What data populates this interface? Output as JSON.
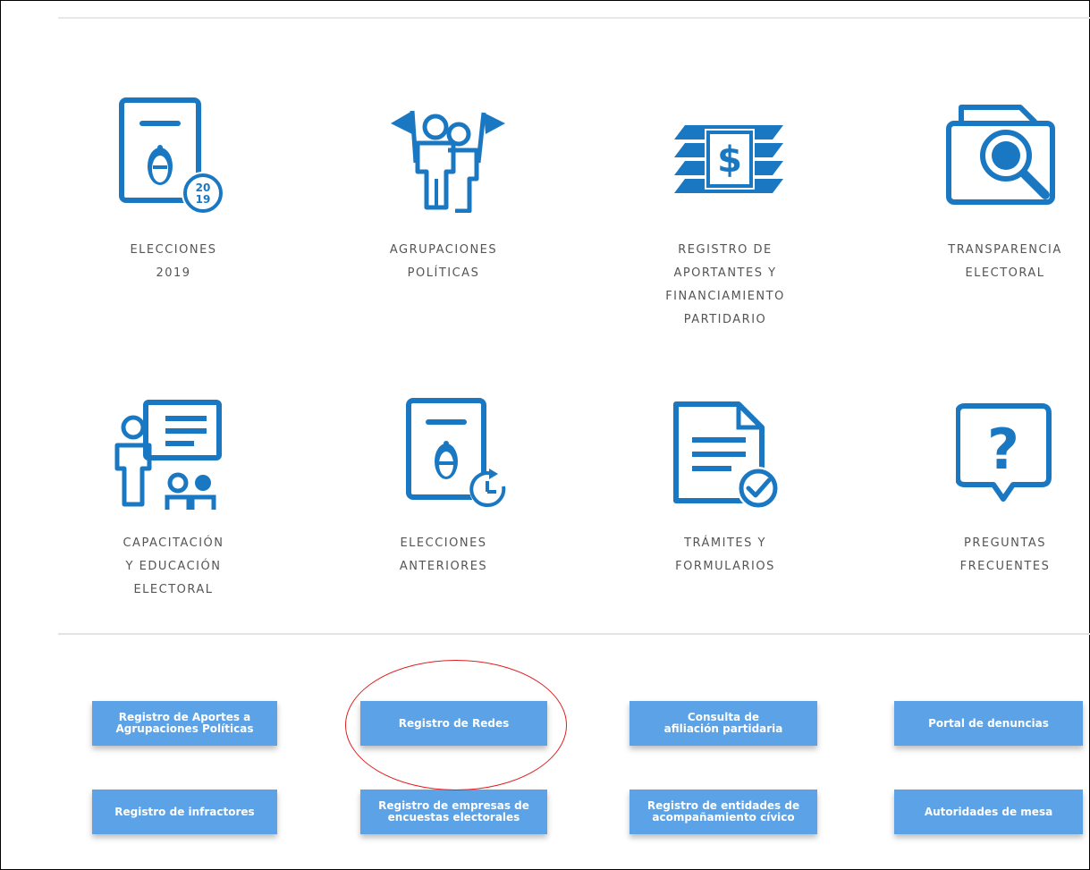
{
  "tiles": [
    {
      "label": "ELECCIONES\n2019",
      "icon": "ballot-2019-icon"
    },
    {
      "label": "AGRUPACIONES\nPOLÍTICAS",
      "icon": "political-groups-icon"
    },
    {
      "label": "REGISTRO DE\nAPORTANTES Y\nFINANCIAMIENTO\nPARTIDARIO",
      "icon": "money-stack-icon"
    },
    {
      "label": "TRANSPARENCIA\nELECTORAL",
      "icon": "magnifier-document-icon"
    },
    {
      "label": "CAPACITACIÓN\nY EDUCACIÓN\nELECTORAL",
      "icon": "teacher-classroom-icon"
    },
    {
      "label": "ELECCIONES\nANTERIORES",
      "icon": "ballot-history-icon"
    },
    {
      "label": "TRÁMITES Y\nFORMULARIOS",
      "icon": "form-checkmark-icon"
    },
    {
      "label": "PREGUNTAS\nFRECUENTES",
      "icon": "question-bubble-icon"
    }
  ],
  "buttons": [
    {
      "label": "Registro de Aportes a\nAgrupaciones Políticas"
    },
    {
      "label": "Registro de Redes"
    },
    {
      "label": "Consulta de\nafiliación partidaria"
    },
    {
      "label": "Portal de denuncias"
    },
    {
      "label": "Registro de infractores"
    },
    {
      "label": "Registro de empresas de\nencuestas electorales"
    },
    {
      "label": "Registro de entidades de\nacompañamiento cívico"
    },
    {
      "label": "Autoridades de mesa"
    }
  ],
  "badge": {
    "year_top": "20",
    "year_bottom": "19"
  },
  "colors": {
    "icon_blue": "#1a78c2",
    "button_blue": "#5ca2e6",
    "highlight_red": "#e02020"
  }
}
